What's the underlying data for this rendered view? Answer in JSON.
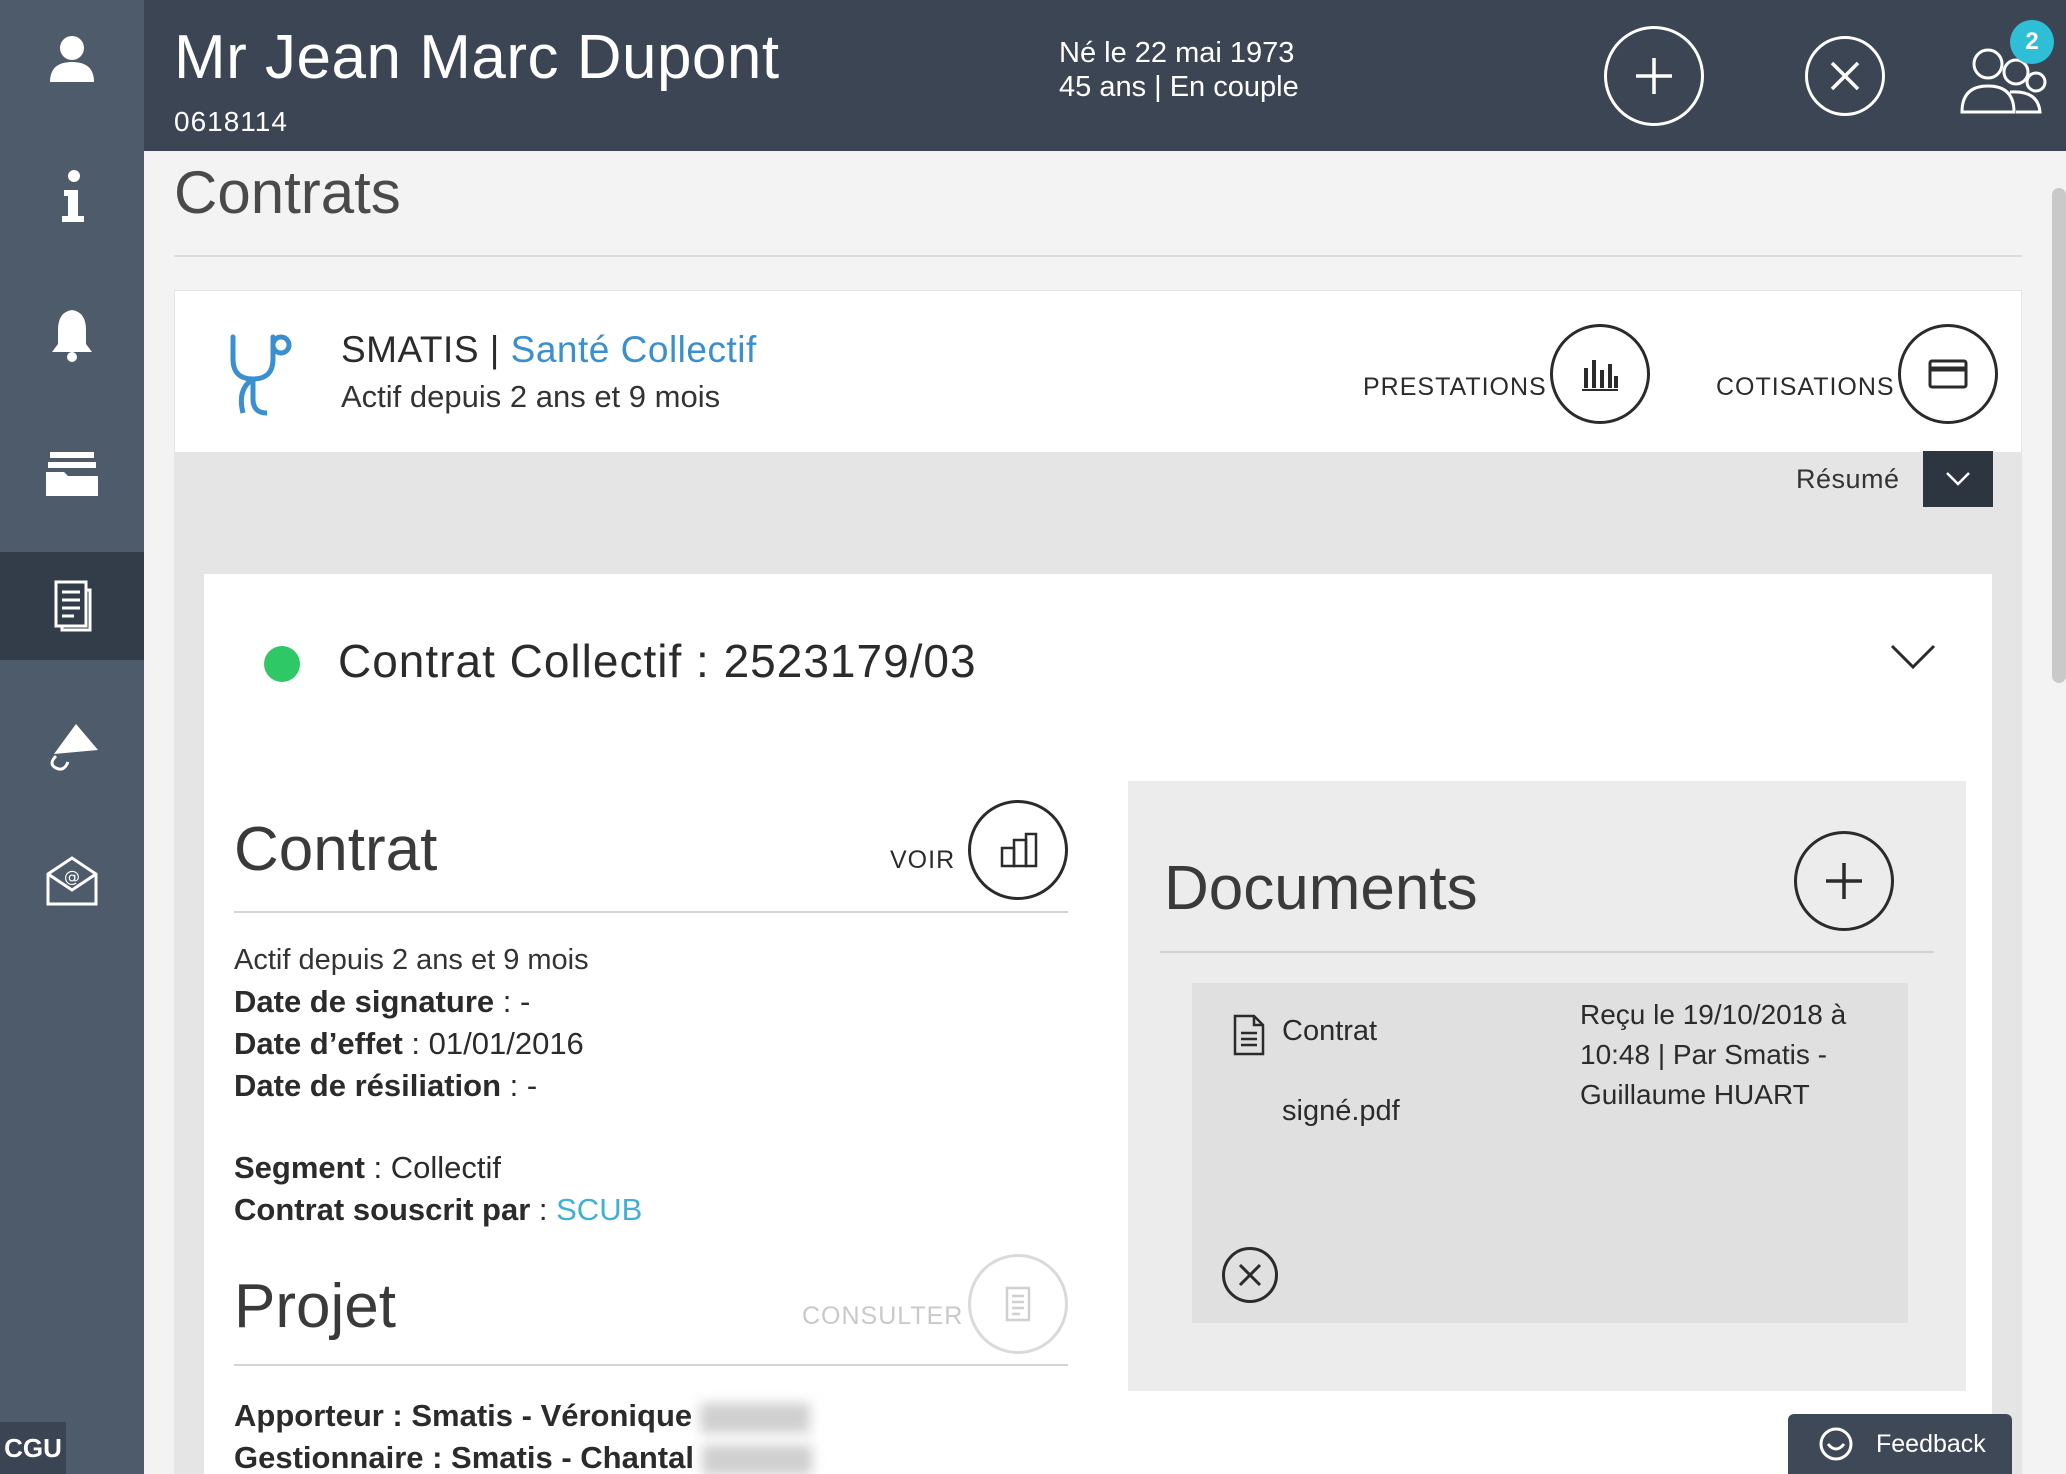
{
  "header": {
    "name": "Mr Jean Marc Dupont",
    "id": "0618114",
    "birth": "Né le 22 mai 1973",
    "age_status": "45 ans | En couple",
    "notification_count": "2"
  },
  "sidebar": {
    "items": [
      {
        "icon": "user-icon"
      },
      {
        "icon": "info-icon"
      },
      {
        "icon": "bell-icon"
      },
      {
        "icon": "folders-icon"
      },
      {
        "icon": "document-icon",
        "active": true
      },
      {
        "icon": "megaphone-icon"
      },
      {
        "icon": "mail-icon"
      }
    ],
    "cgu_label": "CGU"
  },
  "page": {
    "title": "Contrats"
  },
  "product": {
    "brand": "SMATIS",
    "separator": " | ",
    "name": "Santé Collectif",
    "status": "Actif depuis 2 ans et 9 mois",
    "prestations_label": "PRESTATIONS",
    "cotisations_label": "COTISATIONS",
    "resume_label": "Résumé"
  },
  "contract": {
    "title": "Contrat Collectif : 2523179/03",
    "status_color": "#2ec866",
    "section_title": "Contrat",
    "voir_label": "VOIR",
    "status_text": "Actif depuis 2 ans et 9 mois",
    "signature_label": "Date de signature",
    "signature_value": " : -",
    "effet_label": "Date d’effet",
    "effet_value": " : 01/01/2016",
    "resiliation_label": "Date de résiliation",
    "resiliation_value": " : -",
    "segment_label": "Segment",
    "segment_value": " : Collectif",
    "souscrit_label": "Contrat souscrit par",
    "souscrit_sep": " : ",
    "souscrit_value": "SCUB"
  },
  "projet": {
    "section_title": "Projet",
    "consulter_label": "CONSULTER",
    "apporteur_label": "Apporteur : Smatis - Véronique",
    "gestionnaire_label": "Gestionnaire : Smatis - Chantal"
  },
  "documents": {
    "title": "Documents",
    "items": [
      {
        "name_line1": "Contrat",
        "name_line2": "signé.pdf",
        "meta": "Reçu le 19/10/2018 à 10:48 | Par Smatis - Guillaume HUART"
      }
    ]
  },
  "feedback": {
    "label": "Feedback"
  },
  "colors": {
    "header_bg": "#3c4553",
    "sidebar_bg": "#4d5b6b",
    "accent_blue": "#3a8fd0",
    "link": "#3fb0d6",
    "badge": "#2ebfd6"
  }
}
